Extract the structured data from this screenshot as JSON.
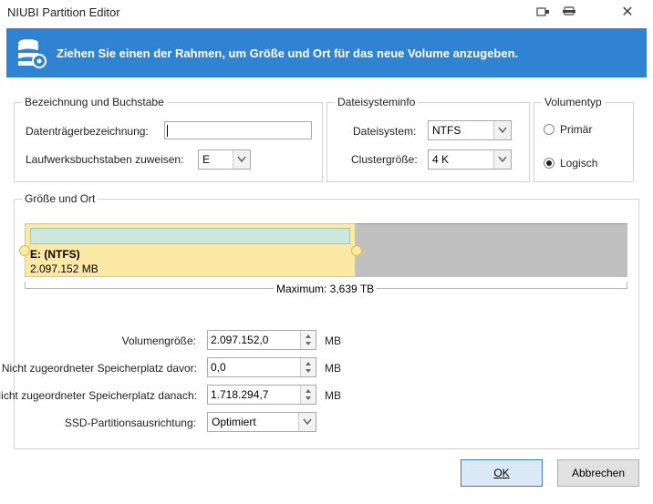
{
  "window": {
    "title": "NIUBI Partition Editor",
    "icons": [
      "pin-icon",
      "settings-icon"
    ],
    "close_glyph": "✕"
  },
  "banner": {
    "text": "Ziehen Sie einen der Rahmen, um Größe und Ort für das neue Volume anzugeben.",
    "color": "#2f83d2"
  },
  "labels_group": {
    "title": "Bezeichnung und Buchstabe",
    "volume_label_caption": "Datenträgerbezeichnung:",
    "volume_label_value": "",
    "drive_letter_caption": "Laufwerksbuchstaben zuweisen:",
    "drive_letter_value": "E"
  },
  "fs_group": {
    "title": "Dateisysteminfo",
    "filesystem_caption": "Dateisystem:",
    "filesystem_value": "NTFS",
    "cluster_caption": "Clustergröße:",
    "cluster_value": "4 K"
  },
  "voltype_group": {
    "title": "Volumentyp",
    "primary_label": "Primär",
    "logical_label": "Logisch",
    "selected": "logical"
  },
  "size_group": {
    "title": "Größe und Ort",
    "partition_name": "E: (NTFS)",
    "partition_size": "2.097.152 MB",
    "max_label": "Maximum: 3,639 TB",
    "partition_fraction": 0.5496,
    "colors": {
      "partition": "#fde9a6",
      "used_bar": "#cce8dc",
      "unallocated": "#c0c0c0"
    }
  },
  "fields": {
    "volume_size_caption": "Volumengröße:",
    "volume_size_value": "2.097.152,0",
    "before_caption": "Nicht zugeordneter Speicherplatz davor:",
    "before_value": "0,0",
    "after_caption": "Nicht zugeordneter Speicherplatz danach:",
    "after_value": "1.718.294,7",
    "ssd_caption": "SSD-Partitionsausrichtung:",
    "ssd_value": "Optimiert",
    "unit": "MB"
  },
  "buttons": {
    "ok": "OK",
    "cancel": "Abbrechen"
  }
}
